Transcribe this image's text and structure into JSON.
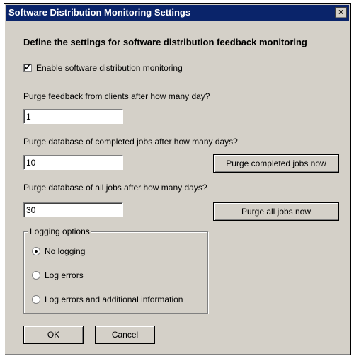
{
  "window": {
    "title": "Software Distribution Monitoring Settings",
    "close_glyph": "×"
  },
  "heading": "Define the settings for software distribution feedback monitoring",
  "enable_monitoring": {
    "label": "Enable software distribution monitoring",
    "checked": true
  },
  "purge_feedback": {
    "label": "Purge feedback from clients after how many day?",
    "value": "1"
  },
  "purge_completed": {
    "label": "Purge database of completed jobs after how many days?",
    "value": "10",
    "button_label": "Purge completed jobs now"
  },
  "purge_all": {
    "label": "Purge database of all jobs after how many days?",
    "value": "30",
    "button_label": "Purge all jobs now"
  },
  "logging": {
    "group_label": "Logging options",
    "options": [
      {
        "label": "No logging",
        "selected": true
      },
      {
        "label": "Log errors",
        "selected": false
      },
      {
        "label": "Log errors and additional information",
        "selected": false
      }
    ]
  },
  "footer": {
    "ok_label": "OK",
    "cancel_label": "Cancel"
  },
  "colors": {
    "titlebar": "#0a246a",
    "dialog_bg": "#d4d0c8"
  },
  "icons": {
    "close": "close-icon",
    "checkbox_check": "check-icon"
  }
}
